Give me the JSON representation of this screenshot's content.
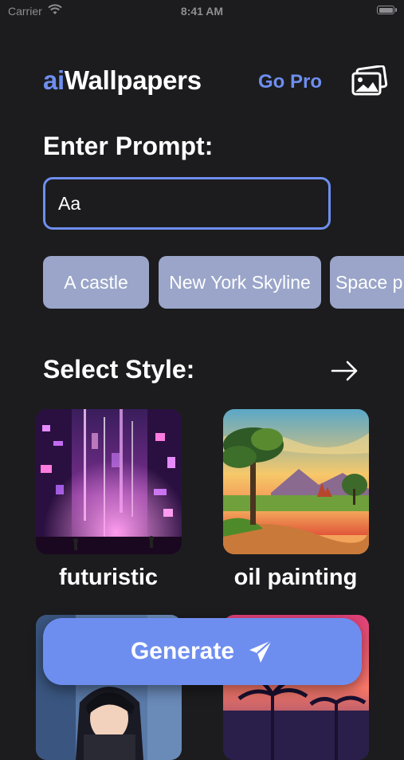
{
  "status_bar": {
    "carrier": "Carrier",
    "time": "8:41 AM"
  },
  "header": {
    "logo_ai": "ai",
    "logo_rest": "Wallpapers",
    "go_pro": "Go Pro",
    "gallery_icon": "photo-gallery-icon"
  },
  "prompt": {
    "title": "Enter Prompt:",
    "placeholder": "Aa",
    "value": ""
  },
  "suggestions": [
    "A castle",
    "New York Skyline",
    "Space p"
  ],
  "style": {
    "title": "Select Style:",
    "arrow_icon": "arrow-right-icon",
    "cards": [
      {
        "label": "futuristic"
      },
      {
        "label": "oil painting"
      },
      {
        "label": ""
      },
      {
        "label": ""
      }
    ]
  },
  "generate": {
    "label": "Generate",
    "icon": "paper-plane-icon"
  },
  "colors": {
    "accent": "#6e8eef",
    "chip_bg": "#9aa5c9",
    "background": "#1c1c1e"
  }
}
